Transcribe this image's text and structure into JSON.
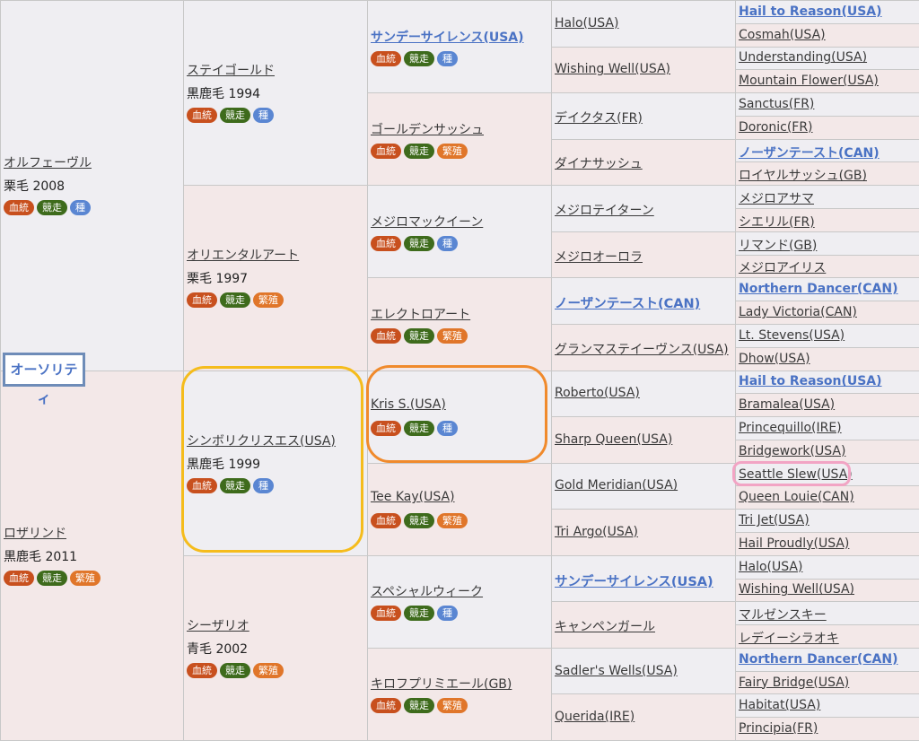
{
  "title_box": "オーソリティ",
  "tags": {
    "ketto": "血統",
    "kyoso": "競走",
    "shu": "種",
    "hanshoku": "繁殖"
  },
  "gen1": [
    {
      "name": "オルフェーヴル",
      "info": "栗毛 2008",
      "tags": [
        "ketto",
        "kyoso",
        "shu"
      ]
    },
    {
      "name": "ロザリンド",
      "info": "黒鹿毛 2011",
      "tags": [
        "ketto",
        "kyoso",
        "hanshoku"
      ]
    }
  ],
  "gen2": [
    {
      "name": "ステイゴールド",
      "info": "黒鹿毛 1994",
      "tags": [
        "ketto",
        "kyoso",
        "shu"
      ]
    },
    {
      "name": "オリエンタルアート",
      "info": "栗毛 1997",
      "tags": [
        "ketto",
        "kyoso",
        "hanshoku"
      ]
    },
    {
      "name": "シンボリクリスエス(USA)",
      "info": "黒鹿毛 1999",
      "tags": [
        "ketto",
        "kyoso",
        "shu"
      ]
    },
    {
      "name": "シーザリオ",
      "info": "青毛 2002",
      "tags": [
        "ketto",
        "kyoso",
        "hanshoku"
      ]
    }
  ],
  "gen3": [
    {
      "name": "サンデーサイレンス(USA)",
      "tags": [
        "ketto",
        "kyoso",
        "shu"
      ],
      "bold": true
    },
    {
      "name": "ゴールデンサッシュ",
      "tags": [
        "ketto",
        "kyoso",
        "hanshoku"
      ]
    },
    {
      "name": "メジロマックイーン",
      "tags": [
        "ketto",
        "kyoso",
        "shu"
      ]
    },
    {
      "name": "エレクトロアート",
      "tags": [
        "ketto",
        "kyoso",
        "hanshoku"
      ]
    },
    {
      "name": "Kris S.(USA)",
      "tags": [
        "ketto",
        "kyoso",
        "shu"
      ]
    },
    {
      "name": "Tee Kay(USA)",
      "tags": [
        "ketto",
        "kyoso",
        "hanshoku"
      ]
    },
    {
      "name": "スペシャルウィーク",
      "tags": [
        "ketto",
        "kyoso",
        "shu"
      ]
    },
    {
      "name": "キロフプリミエール(GB)",
      "tags": [
        "ketto",
        "kyoso",
        "hanshoku"
      ]
    }
  ],
  "gen4": [
    {
      "name": "Halo(USA)"
    },
    {
      "name": "Wishing Well(USA)"
    },
    {
      "name": "デイクタス(FR)"
    },
    {
      "name": "ダイナサッシュ"
    },
    {
      "name": "メジロテイターン"
    },
    {
      "name": "メジロオーロラ"
    },
    {
      "name": "ノーザンテースト(CAN)",
      "bold": true
    },
    {
      "name": "グランマステイーヴンス(USA)"
    },
    {
      "name": "Roberto(USA)"
    },
    {
      "name": "Sharp Queen(USA)"
    },
    {
      "name": "Gold Meridian(USA)"
    },
    {
      "name": "Tri Argo(USA)"
    },
    {
      "name": "サンデーサイレンス(USA)",
      "bold": true
    },
    {
      "name": "キャンペンガール"
    },
    {
      "name": "Sadler's Wells(USA)"
    },
    {
      "name": "Querida(IRE)"
    }
  ],
  "gen5": [
    {
      "name": "Hail to Reason(USA)",
      "bold": true
    },
    {
      "name": "Cosmah(USA)"
    },
    {
      "name": "Understanding(USA)"
    },
    {
      "name": "Mountain Flower(USA)"
    },
    {
      "name": "Sanctus(FR)"
    },
    {
      "name": "Doronic(FR)"
    },
    {
      "name": "ノーザンテースト(CAN)",
      "bold": true
    },
    {
      "name": "ロイヤルサッシュ(GB)"
    },
    {
      "name": "メジロアサマ"
    },
    {
      "name": "シエリル(FR)"
    },
    {
      "name": "リマンド(GB)"
    },
    {
      "name": "メジロアイリス"
    },
    {
      "name": "Northern Dancer(CAN)",
      "bold": true
    },
    {
      "name": "Lady Victoria(CAN)"
    },
    {
      "name": "Lt. Stevens(USA)"
    },
    {
      "name": "Dhow(USA)"
    },
    {
      "name": "Hail to Reason(USA)",
      "bold": true
    },
    {
      "name": "Bramalea(USA)"
    },
    {
      "name": "Princequillo(IRE)"
    },
    {
      "name": "Bridgework(USA)"
    },
    {
      "name": "Seattle Slew(USA)"
    },
    {
      "name": "Queen Louie(CAN)"
    },
    {
      "name": "Tri Jet(USA)"
    },
    {
      "name": "Hail Proudly(USA)"
    },
    {
      "name": "Halo(USA)"
    },
    {
      "name": "Wishing Well(USA)"
    },
    {
      "name": "マルゼンスキー"
    },
    {
      "name": "レデイーシラオキ"
    },
    {
      "name": "Northern Dancer(CAN)",
      "bold": true
    },
    {
      "name": "Fairy Bridge(USA)"
    },
    {
      "name": "Habitat(USA)"
    },
    {
      "name": "Principia(FR)"
    }
  ],
  "highlight_colors": {
    "yellow": "#f5bc1c",
    "orange": "#f08a2c",
    "pink": "#f2a4c4",
    "box_blue": "#6e8cb8"
  }
}
